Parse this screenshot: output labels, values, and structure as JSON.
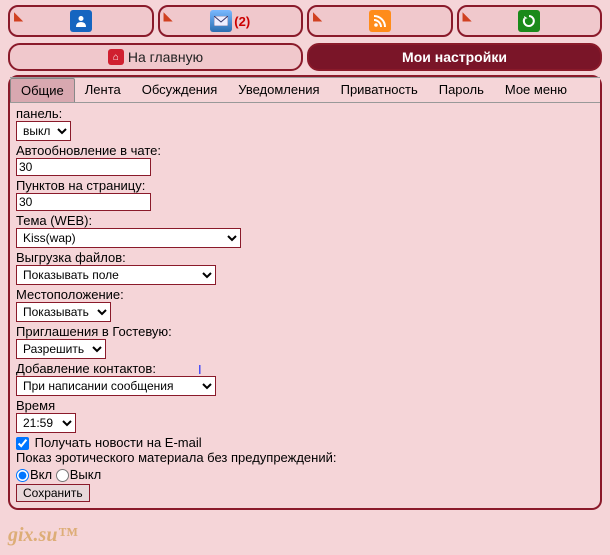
{
  "topbar": {
    "msg_count": "(2)"
  },
  "nav": {
    "home_label": "На главную",
    "settings_label": "Мои настройки"
  },
  "subtabs": {
    "general": "Общие",
    "feed": "Лента",
    "discussions": "Обсуждения",
    "notifications": "Уведомления",
    "privacy": "Приватность",
    "password": "Пароль",
    "mymenu": "Мое меню"
  },
  "form": {
    "panel_label": "панель:",
    "panel_value": "выкл",
    "autorefresh_label": "Автообновление в чате:",
    "autorefresh_value": "30",
    "perpage_label": "Пунктов на страницу:",
    "perpage_value": "30",
    "theme_label": "Тема (WEB):",
    "theme_value": "Kiss(wap)",
    "upload_label": "Выгрузка файлов:",
    "upload_value": "Показывать поле",
    "location_label": "Местоположение:",
    "location_value": "Показывать",
    "guest_label": "Приглашения в Гостевую:",
    "guest_value": "Разрешить",
    "contacts_label": "Добавление контактов:",
    "contacts_value": "При написании сообщения",
    "time_label": "Время",
    "time_value": "21:59",
    "email_news_label": "Получать новости на E-mail",
    "erotic_label": "Показ эротического материала без предупреждений:",
    "radio_on": "Вкл",
    "radio_off": "Выкл",
    "save_label": "Сохранить"
  },
  "watermark": "gix.su™"
}
